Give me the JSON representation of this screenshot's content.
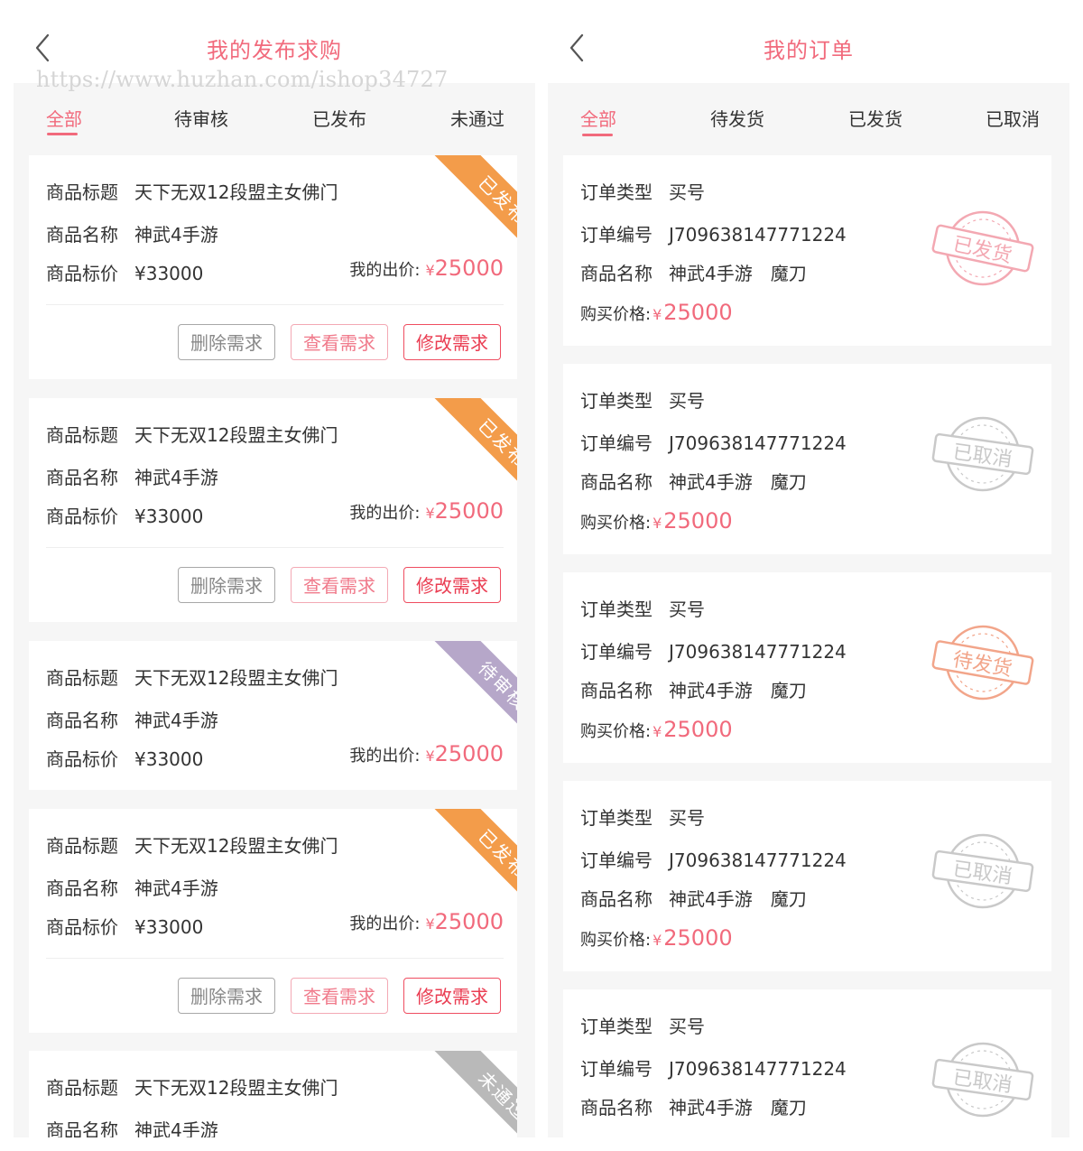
{
  "left": {
    "title": "我的发布求购",
    "watermark": "https://www.huzhan.com/ishop34727",
    "tabs": [
      "全部",
      "待审核",
      "已发布",
      "未通过"
    ],
    "labels": {
      "title": "商品标题",
      "name": "商品名称",
      "price": "商品标价",
      "bid": "我的出价:",
      "currency": "¥"
    },
    "buttons": {
      "delete": "删除需求",
      "view": "查看需求",
      "edit": "修改需求"
    },
    "colors": {
      "accent": "#f16a7c",
      "published": "#f39c4a",
      "pending": "#b6a7c9",
      "rejected": "#b9b9b9"
    },
    "cards": [
      {
        "title": "天下无双12段盟主女佛门",
        "name": "神武4手游",
        "price": "¥33000",
        "bid": "25000",
        "status": "已发布",
        "status_color": "#f39c4a"
      },
      {
        "title": "天下无双12段盟主女佛门",
        "name": "神武4手游",
        "price": "¥33000",
        "bid": "25000",
        "status": "已发布",
        "status_color": "#f39c4a"
      },
      {
        "title": "天下无双12段盟主女佛门",
        "name": "神武4手游",
        "price": "¥33000",
        "bid": "25000",
        "status": "待审核",
        "status_color": "#b6a7c9"
      },
      {
        "title": "天下无双12段盟主女佛门",
        "name": "神武4手游",
        "price": "¥33000",
        "bid": "25000",
        "status": "已发布",
        "status_color": "#f39c4a"
      },
      {
        "title": "天下无双12段盟主女佛门",
        "name": "神武4手游",
        "status": "未通过",
        "status_color": "#b9b9b9"
      }
    ]
  },
  "right": {
    "title": "我的订单",
    "tabs": [
      "全部",
      "待发货",
      "已发货",
      "已取消"
    ],
    "labels": {
      "type": "订单类型",
      "number": "订单编号",
      "name": "商品名称",
      "price": "购买价格:",
      "currency": "¥"
    },
    "orders": [
      {
        "type": "买号",
        "number": "J709638147771224",
        "name": "神武4手游",
        "item": "魔刀",
        "price": "25000",
        "stamp": "已发货",
        "stamp_color": "#f3a8b2"
      },
      {
        "type": "买号",
        "number": "J709638147771224",
        "name": "神武4手游",
        "item": "魔刀",
        "price": "25000",
        "stamp": "已取消",
        "stamp_color": "#c9c9c9"
      },
      {
        "type": "买号",
        "number": "J709638147771224",
        "name": "神武4手游",
        "item": "魔刀",
        "price": "25000",
        "stamp": "待发货",
        "stamp_color": "#f2a58a"
      },
      {
        "type": "买号",
        "number": "J709638147771224",
        "name": "神武4手游",
        "item": "魔刀",
        "price": "25000",
        "stamp": "已取消",
        "stamp_color": "#c9c9c9"
      },
      {
        "type": "买号",
        "number": "J709638147771224",
        "name": "神武4手游",
        "item": "魔刀",
        "stamp": "已取消",
        "stamp_color": "#c9c9c9"
      }
    ]
  }
}
